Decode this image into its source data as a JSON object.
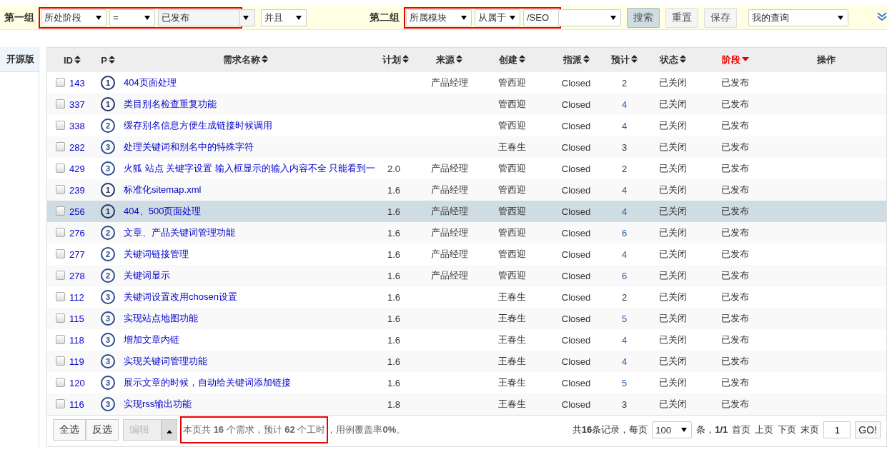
{
  "filter_bar": {
    "group1": {
      "label": "第一组",
      "field": "所处阶段",
      "operator": "=",
      "value": "已发布",
      "logic": "并且",
      "highlighted": true
    },
    "group2": {
      "label": "第二组",
      "field": "所属模块",
      "operator": "从属于",
      "value": "/SEO",
      "highlighted": true
    },
    "buttons": [
      {
        "label": "搜索",
        "selected": true
      },
      {
        "label": "重置",
        "selected": false
      },
      {
        "label": "保存",
        "selected": false
      }
    ],
    "saved_query": "我的查询"
  },
  "sidebar": {
    "items": [
      {
        "label": "开源版",
        "selected": true
      }
    ]
  },
  "table": {
    "columns": [
      {
        "label": "ID",
        "sortable": true,
        "active": false
      },
      {
        "label": "P",
        "sortable": true,
        "active": false
      },
      {
        "label": "需求名称",
        "sortable": true,
        "active": false
      },
      {
        "label": "计划",
        "sortable": true,
        "active": false
      },
      {
        "label": "来源",
        "sortable": true,
        "active": false
      },
      {
        "label": "创建",
        "sortable": true,
        "active": false
      },
      {
        "label": "指派",
        "sortable": true,
        "active": false
      },
      {
        "label": "预计",
        "sortable": true,
        "active": false
      },
      {
        "label": "状态",
        "sortable": true,
        "active": false
      },
      {
        "label": "阶段",
        "sortable": true,
        "active": true
      },
      {
        "label": "操作",
        "sortable": false,
        "active": false
      }
    ],
    "rows": [
      {
        "id": "143",
        "pri": "1",
        "name": "404页面处理",
        "plan": "",
        "source": "产品经理",
        "creator": "管西迎",
        "assigned": "Closed",
        "estimate": "2",
        "status": "已关闭",
        "stage": "已发布",
        "checked": false,
        "selected": false
      },
      {
        "id": "337",
        "pri": "1",
        "name": "类目别名检查重复功能",
        "plan": "",
        "source": "",
        "creator": "管西迎",
        "assigned": "Closed",
        "estimate": "4",
        "status": "已关闭",
        "stage": "已发布",
        "checked": false,
        "selected": false
      },
      {
        "id": "338",
        "pri": "2",
        "name": "缓存别名信息方便生成链接时候调用",
        "plan": "",
        "source": "",
        "creator": "管西迎",
        "assigned": "Closed",
        "estimate": "4",
        "status": "已关闭",
        "stage": "已发布",
        "checked": false,
        "selected": false
      },
      {
        "id": "282",
        "pri": "3",
        "name": "处理关键词和别名中的特殊字符",
        "plan": "",
        "source": "",
        "creator": "王春生",
        "assigned": "Closed",
        "estimate": "3",
        "status": "已关闭",
        "stage": "已发布",
        "checked": false,
        "selected": false
      },
      {
        "id": "429",
        "pri": "3",
        "name": "火狐 站点 关键字设置 输入框显示的输入内容不全 只能看到一",
        "plan": "2.0",
        "source": "产品经理",
        "creator": "管西迎",
        "assigned": "Closed",
        "estimate": "2",
        "status": "已关闭",
        "stage": "已发布",
        "checked": false,
        "selected": false
      },
      {
        "id": "239",
        "pri": "1",
        "name": "标准化sitemap.xml",
        "plan": "1.6",
        "source": "产品经理",
        "creator": "管西迎",
        "assigned": "Closed",
        "estimate": "4",
        "status": "已关闭",
        "stage": "已发布",
        "checked": false,
        "selected": false
      },
      {
        "id": "256",
        "pri": "1",
        "name": "404、500页面处理",
        "plan": "1.6",
        "source": "产品经理",
        "creator": "管西迎",
        "assigned": "Closed",
        "estimate": "4",
        "status": "已关闭",
        "stage": "已发布",
        "checked": false,
        "selected": true
      },
      {
        "id": "276",
        "pri": "2",
        "name": "文章、产品关键词管理功能",
        "plan": "1.6",
        "source": "产品经理",
        "creator": "管西迎",
        "assigned": "Closed",
        "estimate": "6",
        "status": "已关闭",
        "stage": "已发布",
        "checked": false,
        "selected": false
      },
      {
        "id": "277",
        "pri": "2",
        "name": "关键词链接管理",
        "plan": "1.6",
        "source": "产品经理",
        "creator": "管西迎",
        "assigned": "Closed",
        "estimate": "4",
        "status": "已关闭",
        "stage": "已发布",
        "checked": false,
        "selected": false
      },
      {
        "id": "278",
        "pri": "2",
        "name": "关键词显示",
        "plan": "1.6",
        "source": "产品经理",
        "creator": "管西迎",
        "assigned": "Closed",
        "estimate": "6",
        "status": "已关闭",
        "stage": "已发布",
        "checked": false,
        "selected": false
      },
      {
        "id": "112",
        "pri": "3",
        "name": "关键词设置改用chosen设置",
        "plan": "1.6",
        "source": "",
        "creator": "王春生",
        "assigned": "Closed",
        "estimate": "2",
        "status": "已关闭",
        "stage": "已发布",
        "checked": false,
        "selected": false
      },
      {
        "id": "115",
        "pri": "3",
        "name": "实现站点地图功能",
        "plan": "1.6",
        "source": "",
        "creator": "王春生",
        "assigned": "Closed",
        "estimate": "5",
        "status": "已关闭",
        "stage": "已发布",
        "checked": false,
        "selected": false
      },
      {
        "id": "118",
        "pri": "3",
        "name": "增加文章内链",
        "plan": "1.6",
        "source": "",
        "creator": "王春生",
        "assigned": "Closed",
        "estimate": "4",
        "status": "已关闭",
        "stage": "已发布",
        "checked": false,
        "selected": false
      },
      {
        "id": "119",
        "pri": "3",
        "name": "实现关键词管理功能",
        "plan": "1.6",
        "source": "",
        "creator": "王春生",
        "assigned": "Closed",
        "estimate": "4",
        "status": "已关闭",
        "stage": "已发布",
        "checked": false,
        "selected": false
      },
      {
        "id": "120",
        "pri": "3",
        "name": "展示文章的时候，自动给关键词添加链接",
        "plan": "1.6",
        "source": "",
        "creator": "王春生",
        "assigned": "Closed",
        "estimate": "5",
        "status": "已关闭",
        "stage": "已发布",
        "checked": false,
        "selected": false
      },
      {
        "id": "116",
        "pri": "3",
        "name": "实现rss输出功能",
        "plan": "1.8",
        "source": "",
        "creator": "王春生",
        "assigned": "Closed",
        "estimate": "3",
        "status": "已关闭",
        "stage": "已发布",
        "checked": false,
        "selected": false
      }
    ]
  },
  "footer": {
    "select_all": "全选",
    "invert": "反选",
    "edit": {
      "label": "编辑",
      "disabled": true
    },
    "summary_highlight": "本页共 **16** 个需求，预计 **62** 个工时",
    "summary_rest": "，用例覆盖率**0%**。",
    "summary_highlighted": true,
    "records": "共**16**条记录，每页",
    "per_page": "100",
    "page_info": "条，**1/1**",
    "links": [
      "首页",
      "上页",
      "下页",
      "末页"
    ],
    "page_input": "1",
    "go": "GO!"
  }
}
